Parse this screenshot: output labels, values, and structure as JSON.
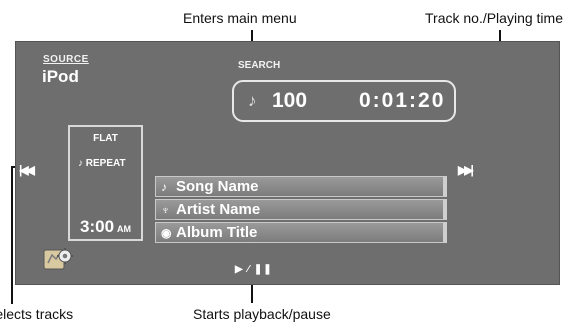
{
  "callouts": {
    "main_menu": "Enters main menu",
    "track_time": "Track no./Playing time",
    "select_tracks": "Selects tracks",
    "playback": "Starts playback/pause"
  },
  "screen": {
    "source_label": "SOURCE",
    "source_value": "iPod",
    "search_label": "SEARCH",
    "track_number": "100",
    "playing_time": "0:01:20",
    "eq_mode": "FLAT",
    "repeat_mode": "REPEAT",
    "clock_time": "3:00",
    "clock_ampm": "AM",
    "song_name": "Song Name",
    "artist_name": "Artist Name",
    "album_title": "Album Title",
    "prev_icon": "skip-previous-icon",
    "next_icon": "skip-next-icon",
    "play_pause_icon": "play-pause-icon"
  },
  "colors": {
    "screen_bg": "#6e6e6e",
    "text": "#ffffff"
  }
}
